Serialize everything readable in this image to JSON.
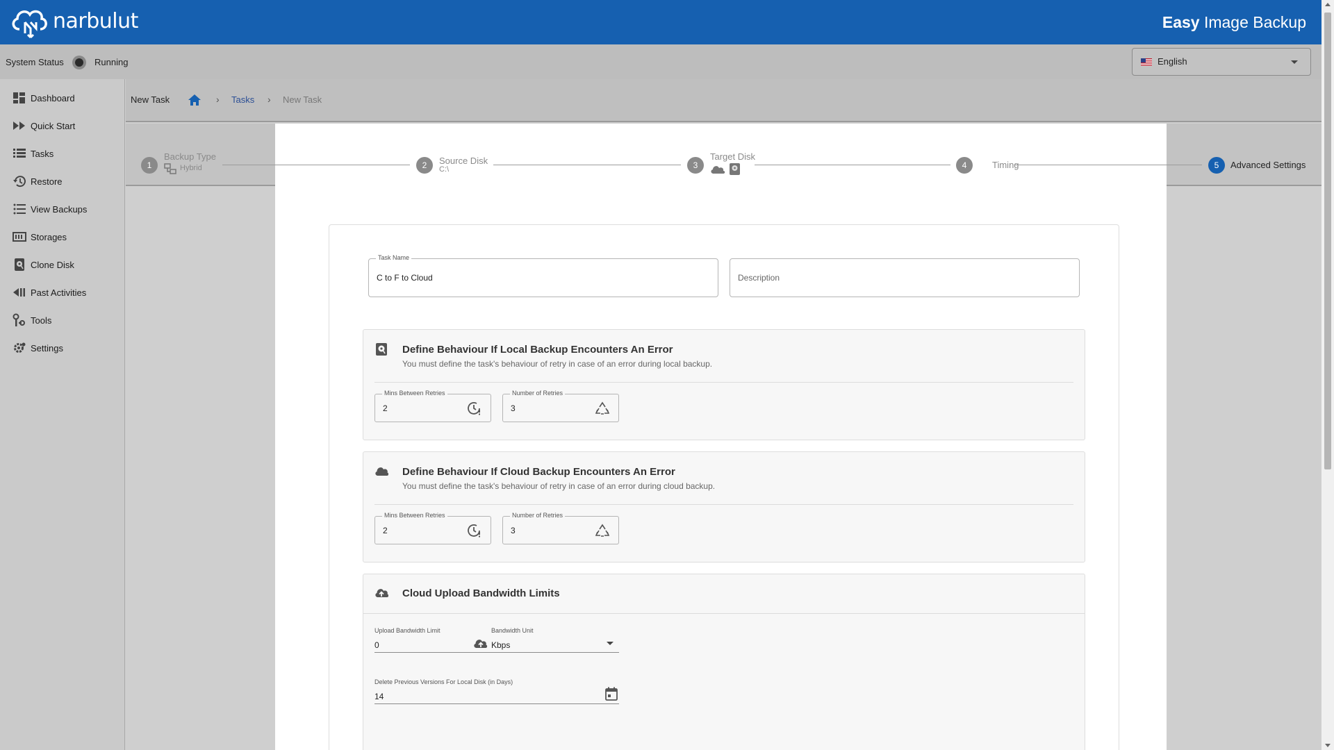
{
  "header": {
    "logo_text": "narbulut",
    "app_title_bold": "Easy",
    "app_title_rest": " Image Backup"
  },
  "status": {
    "label": "System Status",
    "value": "Running"
  },
  "language": {
    "selected": "English"
  },
  "sidebar": {
    "items": [
      {
        "label": "Dashboard",
        "icon": "dashboard-icon"
      },
      {
        "label": "Quick Start",
        "icon": "fast-forward-icon"
      },
      {
        "label": "Tasks",
        "icon": "tasks-list-icon"
      },
      {
        "label": "Restore",
        "icon": "restore-icon"
      },
      {
        "label": "View Backups",
        "icon": "list-icon"
      },
      {
        "label": "Storages",
        "icon": "storage-icon"
      },
      {
        "label": "Clone Disk",
        "icon": "disk-icon"
      },
      {
        "label": "Past Activities",
        "icon": "rewind-icon"
      },
      {
        "label": "Tools",
        "icon": "tools-icon"
      },
      {
        "label": "Settings",
        "icon": "gear-icon"
      }
    ]
  },
  "breadcrumb": {
    "page_title": "New Task",
    "sep": "›",
    "tasks_link": "Tasks",
    "current": "New Task"
  },
  "stepper": {
    "steps": [
      {
        "number": "1",
        "label": "Backup Type",
        "sub": "Hybrid"
      },
      {
        "number": "2",
        "label": "Source Disk",
        "sub": "C:\\"
      },
      {
        "number": "3",
        "label": "Target Disk",
        "sub": ""
      },
      {
        "number": "4",
        "label": "Timing",
        "sub": ""
      },
      {
        "number": "5",
        "label": "Advanced Settings",
        "sub": ""
      }
    ],
    "active_step": 5
  },
  "form": {
    "task_name": {
      "label": "Task Name",
      "value": "C to F to Cloud"
    },
    "description": {
      "placeholder": "Description"
    }
  },
  "local_error": {
    "title": "Define Behaviour If Local Backup Encounters An Error",
    "desc": "You must define the task's behaviour of retry in case of an error during local backup.",
    "mins_label": "Mins Between Retries",
    "mins_value": "2",
    "retries_label": "Number of Retries",
    "retries_value": "3"
  },
  "cloud_error": {
    "title": "Define Behaviour If Cloud Backup Encounters An Error",
    "desc": "You must define the task's behaviour of retry in case of an error during cloud backup.",
    "mins_label": "Mins Between Retries",
    "mins_value": "2",
    "retries_label": "Number of Retries",
    "retries_value": "3"
  },
  "bandwidth": {
    "title": "Cloud Upload Bandwidth Limits",
    "upload_label": "Upload Bandwidth Limit",
    "upload_value": "0",
    "unit_label": "Bandwidth Unit",
    "unit_value": "Kbps",
    "delete_label": "Delete Previous Versions For Local Disk (in Days)",
    "delete_value": "14"
  },
  "colors": {
    "brand": "#1660b0",
    "link": "#2b4f95"
  }
}
